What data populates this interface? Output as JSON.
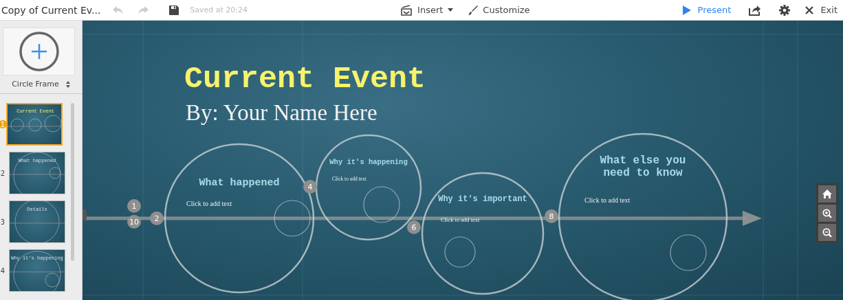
{
  "toolbar": {
    "title": "Copy of Current Ev...",
    "undo": {
      "disabled": true
    },
    "redo": {
      "disabled": true
    },
    "status": "Saved at 20:24",
    "menus": [
      {
        "label": "Insert",
        "kind": "insert"
      },
      {
        "label": "Customize",
        "kind": "customize"
      }
    ],
    "present": "Present",
    "exit": "Exit"
  },
  "sidebar": {
    "frame_type": "Circle Frame",
    "slides": [
      {
        "number": "1",
        "title": "Current Event",
        "selected": true
      },
      {
        "number": "2",
        "title": "What happened",
        "selected": false
      },
      {
        "number": "3",
        "title": "Details",
        "selected": false
      },
      {
        "number": "4",
        "title": "Why it's happening",
        "selected": false
      }
    ]
  },
  "canvas": {
    "title": "Current Event",
    "subtitle": "By: Your Name Here",
    "frames": [
      {
        "heading": "What happened",
        "body": "Click to add text"
      },
      {
        "heading": "Why it's happening",
        "body": "Click to add text"
      },
      {
        "heading": "Why it's important",
        "body": "Click to add text"
      },
      {
        "heading": "What else you need to know",
        "body": "Click to add text"
      }
    ],
    "path_points": [
      "1",
      "10",
      "2",
      "4",
      "6",
      "8"
    ]
  }
}
